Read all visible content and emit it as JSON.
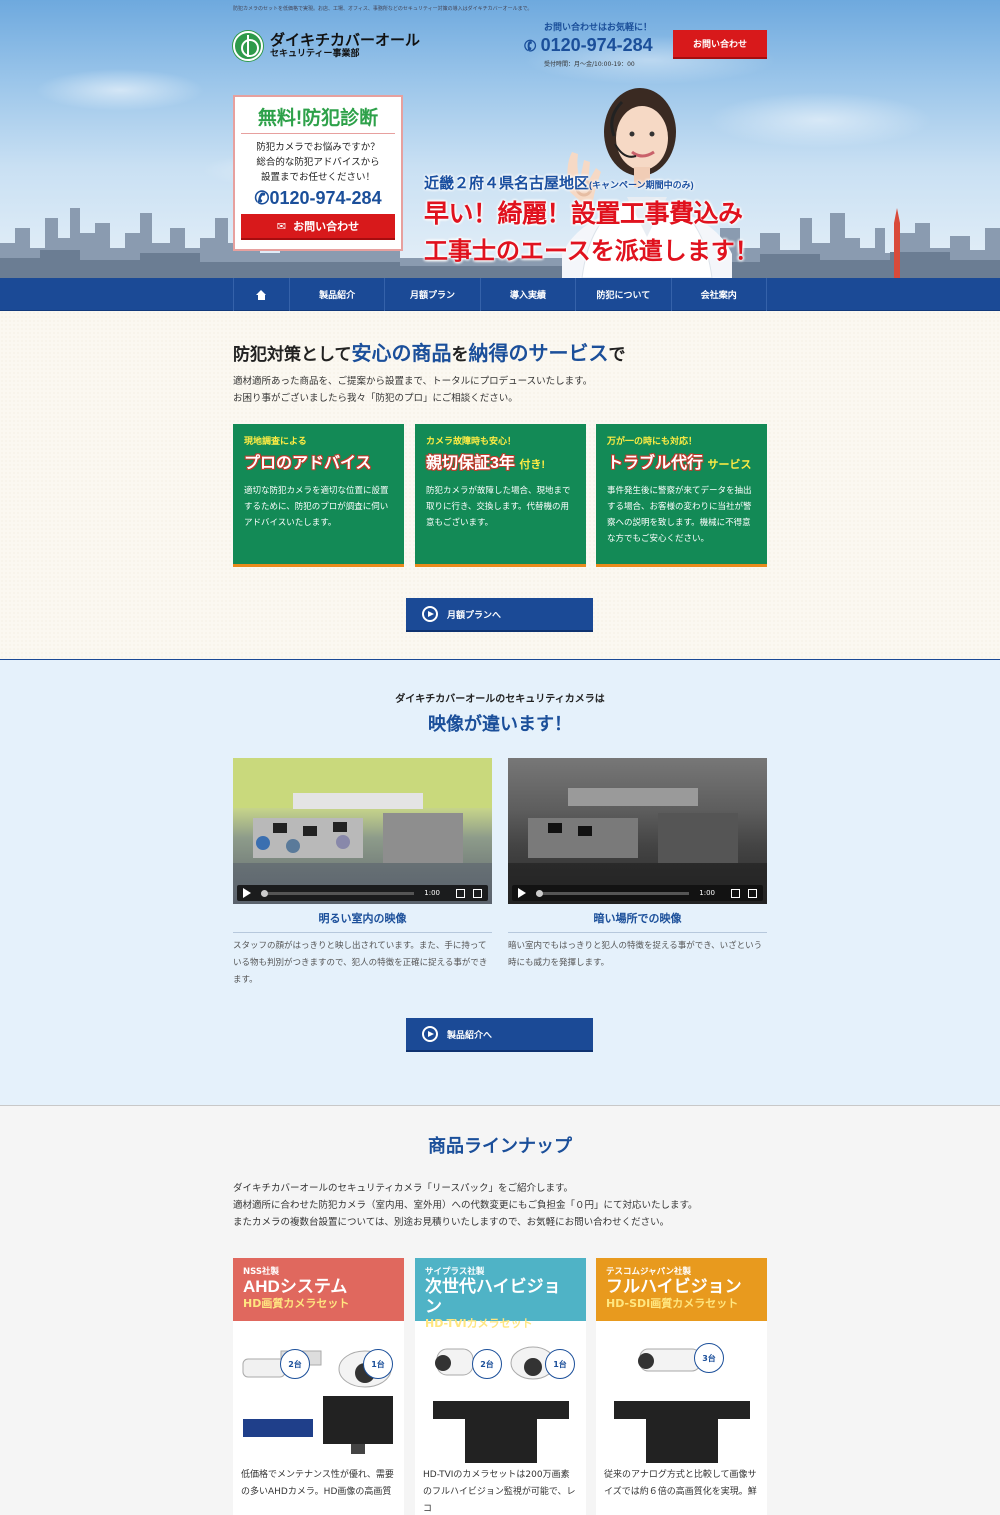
{
  "header": {
    "tagline": "防犯カメラのセットを低価格で実現。お店、工場、オフィス、事務所などのセキュリティー対策の導入はダイキチカバーオールまで。",
    "logo_main": "ダイキチカバーオール",
    "logo_sub": "セキュリティー事業部",
    "contact_label": "お問い合わせはお気軽に！",
    "phone": "0120-974-284",
    "hours": "受付時間：月～金/10:00-19：00",
    "contact_button": "お問い合わせ"
  },
  "hero": {
    "diag_title_a": "無料",
    "diag_title_b": "!",
    "diag_title_c": "防犯診断",
    "diag_text_1": "防犯カメラでお悩みですか？",
    "diag_text_2": "総合的な防犯アドバイスから",
    "diag_text_3": "設置までお任せください！",
    "diag_phone": "0120-974-284",
    "diag_button": "お問い合わせ",
    "copy_1": "近畿２府４県名古屋地区",
    "copy_1_small": "(キャンペーン期間中のみ)",
    "copy_2": "早い！綺麗！設置工事費込み",
    "copy_3": "工事士のエースを派遣します！"
  },
  "nav": {
    "items": [
      "製品紹介",
      "月額プラン",
      "導入実績",
      "防犯について",
      "会社案内"
    ]
  },
  "sec1": {
    "heading_a": "防犯対策として",
    "heading_b": "安心の商品",
    "heading_c": "を",
    "heading_d": "納得のサービス",
    "heading_e": "で",
    "text_1": "適材適所あった商品を、ご提案から設置まで、トータルにプロデュースいたします。",
    "text_2": "お困り事がございましたら我々「防犯のプロ」にご相談ください。",
    "cards": [
      {
        "lead": "現地調査による",
        "title": "プロのアドバイス",
        "title_suffix": "",
        "body": "適切な防犯カメラを適切な位置に設置するために、防犯のプロが調査に伺いアドバイスいたします。"
      },
      {
        "lead": "カメラ故障時も安心！",
        "title": "親切保証3年",
        "title_suffix": "付き!",
        "body": "防犯カメラが故障した場合、現地まで取りに行き、交換します。代替機の用意もございます。"
      },
      {
        "lead": "万が一の時にも対応！",
        "title": "トラブル代行",
        "title_suffix": "サービス",
        "body": "事件発生後に警察が来てデータを抽出する場合、お客様の変わりに当社が警察への説明を致します。機械に不得意な方でもご安心ください。"
      }
    ],
    "button": "月額プランへ"
  },
  "sec2": {
    "lead": "ダイキチカバーオールのセキュリティカメラは",
    "title": "映像が違います！",
    "videos": [
      {
        "time": "1:00",
        "caption": "明るい室内の映像",
        "desc": "スタッフの顔がはっきりと映し出されています。また、手に持っている物も判別がつきますので、犯人の特徴を正確に捉える事ができます。"
      },
      {
        "time": "1:00",
        "caption": "暗い場所での映像",
        "desc": "暗い室内でもはっきりと犯人の特徴を捉える事ができ、いざという時にも威力を発揮します。"
      }
    ],
    "button": "製品紹介へ"
  },
  "sec3": {
    "title": "商品ラインナップ",
    "text_1": "ダイキチカバーオールのセキュリティカメラ「リースパック」をご紹介します。",
    "text_2": "適材適所に合わせた防犯カメラ（室内用、室外用）への代数変更にもご負担金「０円」にて対応いたします。",
    "text_3": "またカメラの複数台設置については、別途お見積りいたしますので、お気軽にお問い合わせください。",
    "products": [
      {
        "maker": "NSS社製",
        "name": "AHDシステム",
        "sub": "HD画質カメラセット",
        "color": "#e0685e",
        "badges": [
          "2台",
          "1台"
        ],
        "desc": "低価格でメンテナンス性が優れ、需要の多いAHDカメラ。HD画像の高画質"
      },
      {
        "maker": "サイプラス社製",
        "name": "次世代ハイビジョン",
        "sub": "HD-TVIカメラセット",
        "color": "#4fb3c6",
        "badges": [
          "2台",
          "1台"
        ],
        "desc": "HD-TVIのカメラセットは200万画素のフルハイビジョン監視が可能で、レコ"
      },
      {
        "maker": "テスコムジャパン社製",
        "name": "フルハイビジョン",
        "sub": "HD-SDI画質カメラセット",
        "color": "#e89a1e",
        "badges": [
          "3台"
        ],
        "desc": "従来のアナログ方式と比較して画像サイズでは約６倍の高画質化を実現。鮮"
      }
    ]
  }
}
